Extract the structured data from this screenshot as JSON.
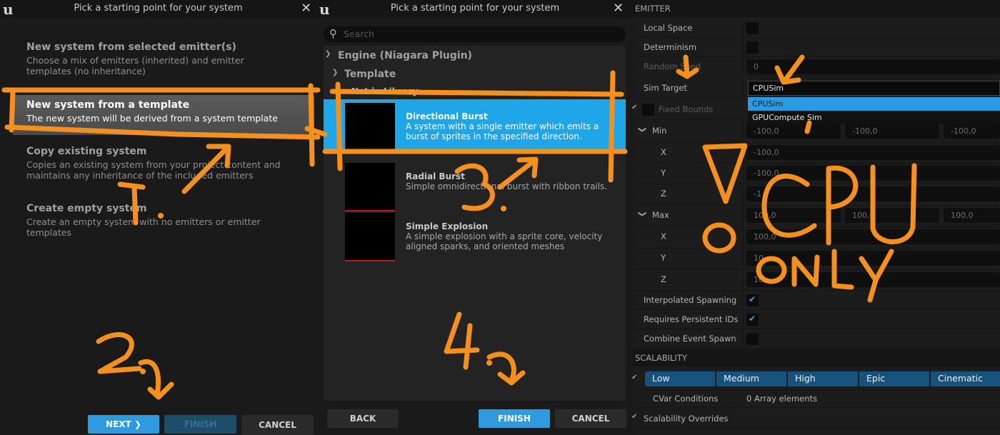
{
  "dialog1": {
    "logo": "u",
    "title": "Pick a starting point for your system",
    "close": "✕",
    "options": [
      {
        "title": "New system from selected emitter(s)",
        "desc": "Choose a mix of emitters (inherited) and emitter templates (no inheritance)"
      },
      {
        "title": "New system from a template",
        "desc": "The new system will be derived from a system template"
      },
      {
        "title": "Copy existing system",
        "desc": "Copies an existing system from your project content and maintains any inheritance of the included emitters"
      },
      {
        "title": "Create empty system",
        "desc": "Create an empty system with no emitters or emitter templates"
      }
    ],
    "next_label": "NEXT ❯",
    "finish_label": "FINISH",
    "cancel_label": "CANCEL"
  },
  "dialog2": {
    "logo": "u",
    "title": "Pick a starting point for your system",
    "close": "✕",
    "search_icon": "search-icon",
    "search_placeholder": "Search",
    "tree": {
      "root": "Engine (Niagara Plugin)",
      "category": "Template",
      "sub": "Not in Library"
    },
    "templates": [
      {
        "name": "Directional Burst",
        "desc": "A system with a single emitter which emits a burst of sprites in the specified direction."
      },
      {
        "name": "Radial Burst",
        "desc": "Simple omnidirectional burst with ribbon trails."
      },
      {
        "name": "Simple Explosion",
        "desc": "A simple explosion with a sprite core, velocity aligned sparks, and oriented meshes"
      }
    ],
    "back_label": "BACK",
    "finish_label": "FINISH",
    "cancel_label": "CANCEL"
  },
  "details": {
    "emitter_header": "EMITTER",
    "local_space": "Local Space",
    "determinism": "Determinism",
    "random_seed": "Random Seed",
    "random_seed_value": "0",
    "sim_target": "Sim Target",
    "sim_target_value": "CPUSim",
    "sim_target_options": [
      "CPUSim",
      "GPUCompute Sim"
    ],
    "fixed_bounds": "Fixed Bounds",
    "min": "Min",
    "max": "Max",
    "x": "X",
    "y": "Y",
    "z": "Z",
    "min_vals": [
      "-100,0",
      "-100,0",
      "-100,0"
    ],
    "min_x": "-100,0",
    "min_y": "-100,0",
    "min_z": "-1",
    "max_vals": [
      "100,0",
      "100,0",
      "100,0"
    ],
    "max_x": "100,0",
    "max_y": "10",
    "max_z": "10",
    "interpolated_spawning": "Interpolated Spawning",
    "requires_persistent_ids": "Requires Persistent IDs",
    "combine_event_spawn": "Combine Event Spawn",
    "scalability_header": "SCALABILITY",
    "tiers": [
      "Low",
      "Medium",
      "High",
      "Epic",
      "Cinematic"
    ],
    "cvar_conditions": "CVar Conditions",
    "cvar_value": "0 Array elements",
    "scalability_overrides": "Scalability Overrides",
    "accent": "#1ea6e8"
  },
  "annotations": {
    "color": "#f5901e",
    "step1": "1.",
    "step2": "2.",
    "step3": "3.",
    "step4": "4.",
    "note_big": "CPU",
    "note_small": "ONLY"
  }
}
